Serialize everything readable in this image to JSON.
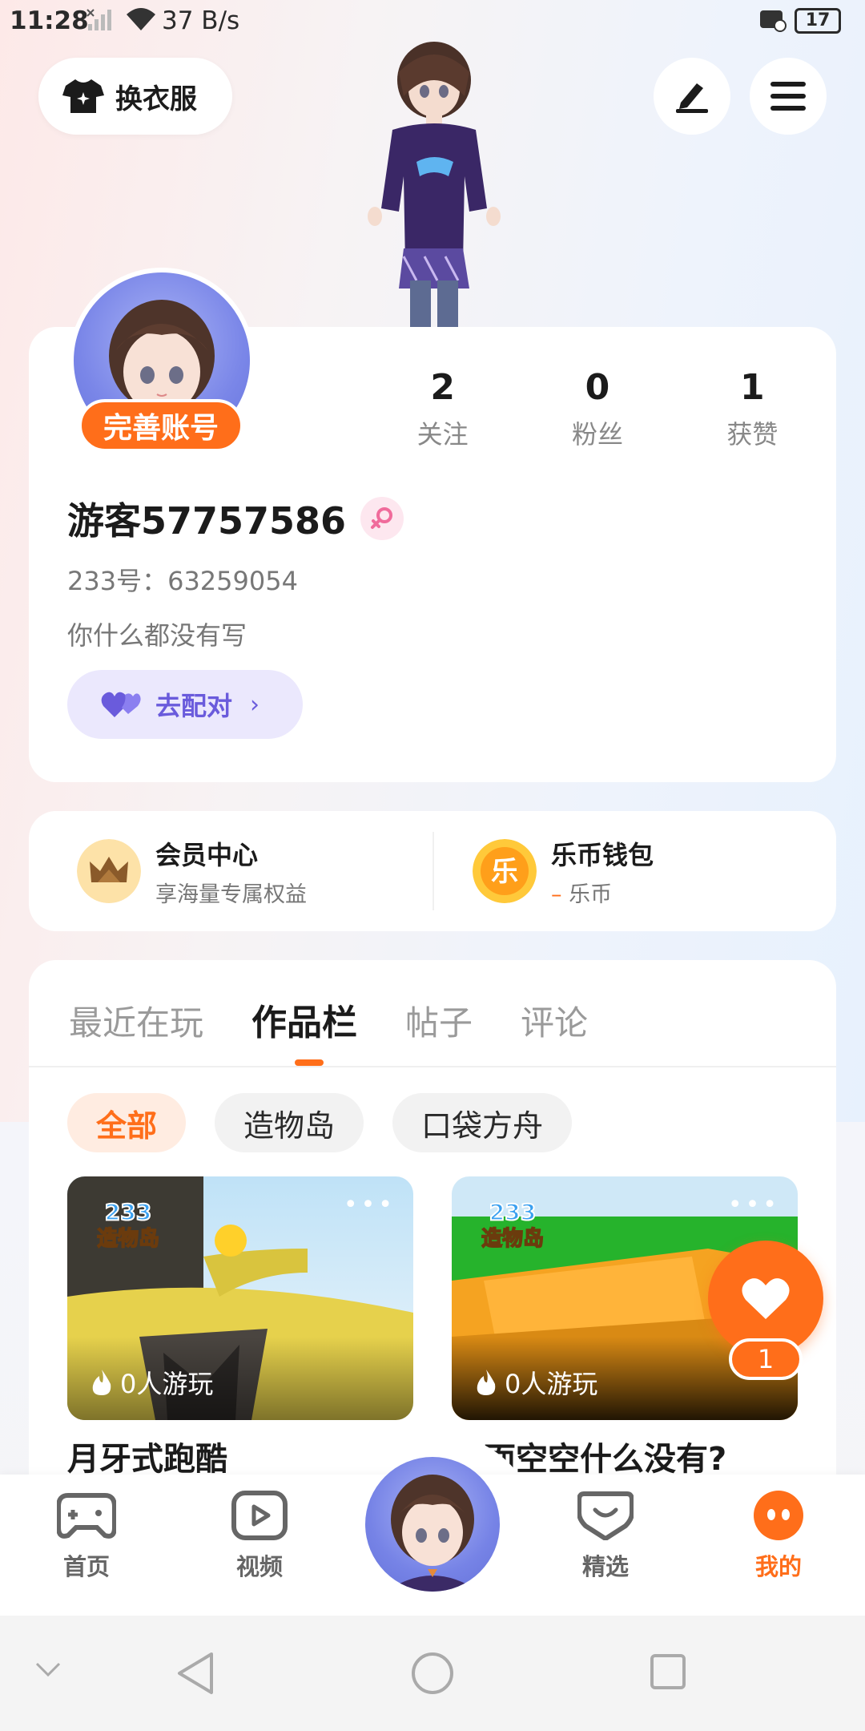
{
  "status_bar": {
    "time": "11:28",
    "network_speed": "37 B/s",
    "battery": "17"
  },
  "header": {
    "outfit_button": "换衣服",
    "edit_icon": "pen-icon",
    "menu_icon": "hamburger-icon"
  },
  "profile": {
    "complete_account": "完善账号",
    "stats": [
      {
        "value": "2",
        "label": "关注"
      },
      {
        "value": "0",
        "label": "粉丝"
      },
      {
        "value": "1",
        "label": "获赞"
      }
    ],
    "username": "游客57757586",
    "gender_icon": "female-icon",
    "uid": "233号：63259054",
    "bio": "你什么都没有写",
    "match_button": "去配对"
  },
  "member": {
    "vip_title": "会员中心",
    "vip_subtitle": "享海量专属权益",
    "wallet_title": "乐币钱包",
    "wallet_dash": "–",
    "wallet_subtitle": "乐币",
    "wallet_glyph": "乐"
  },
  "works": {
    "tabs": [
      "最近在玩",
      "作品栏",
      "帖子",
      "评论"
    ],
    "active_tab": 1,
    "chips": [
      "全部",
      "造物岛",
      "口袋方舟"
    ],
    "active_chip": 0,
    "games": [
      {
        "title": "月牙式跑酷",
        "plays": "0人游玩",
        "badge_num": "233",
        "badge_name": "造物岛"
      },
      {
        "title": "外面空空什么没有?",
        "plays": "0人游玩",
        "badge_num": "233",
        "badge_name": "造物岛"
      }
    ],
    "more": "•••"
  },
  "floating_like": {
    "count": "1"
  },
  "bottom_nav": {
    "items": [
      {
        "label": "首页",
        "icon": "gamepad-icon"
      },
      {
        "label": "视频",
        "icon": "play-icon"
      },
      {
        "label": "精选",
        "icon": "heart-chat-icon"
      },
      {
        "label": "我的",
        "icon": "profile-face-icon"
      }
    ],
    "active": 3
  },
  "colors": {
    "accent": "#ff6e1a",
    "match": "#6a5bdc"
  }
}
